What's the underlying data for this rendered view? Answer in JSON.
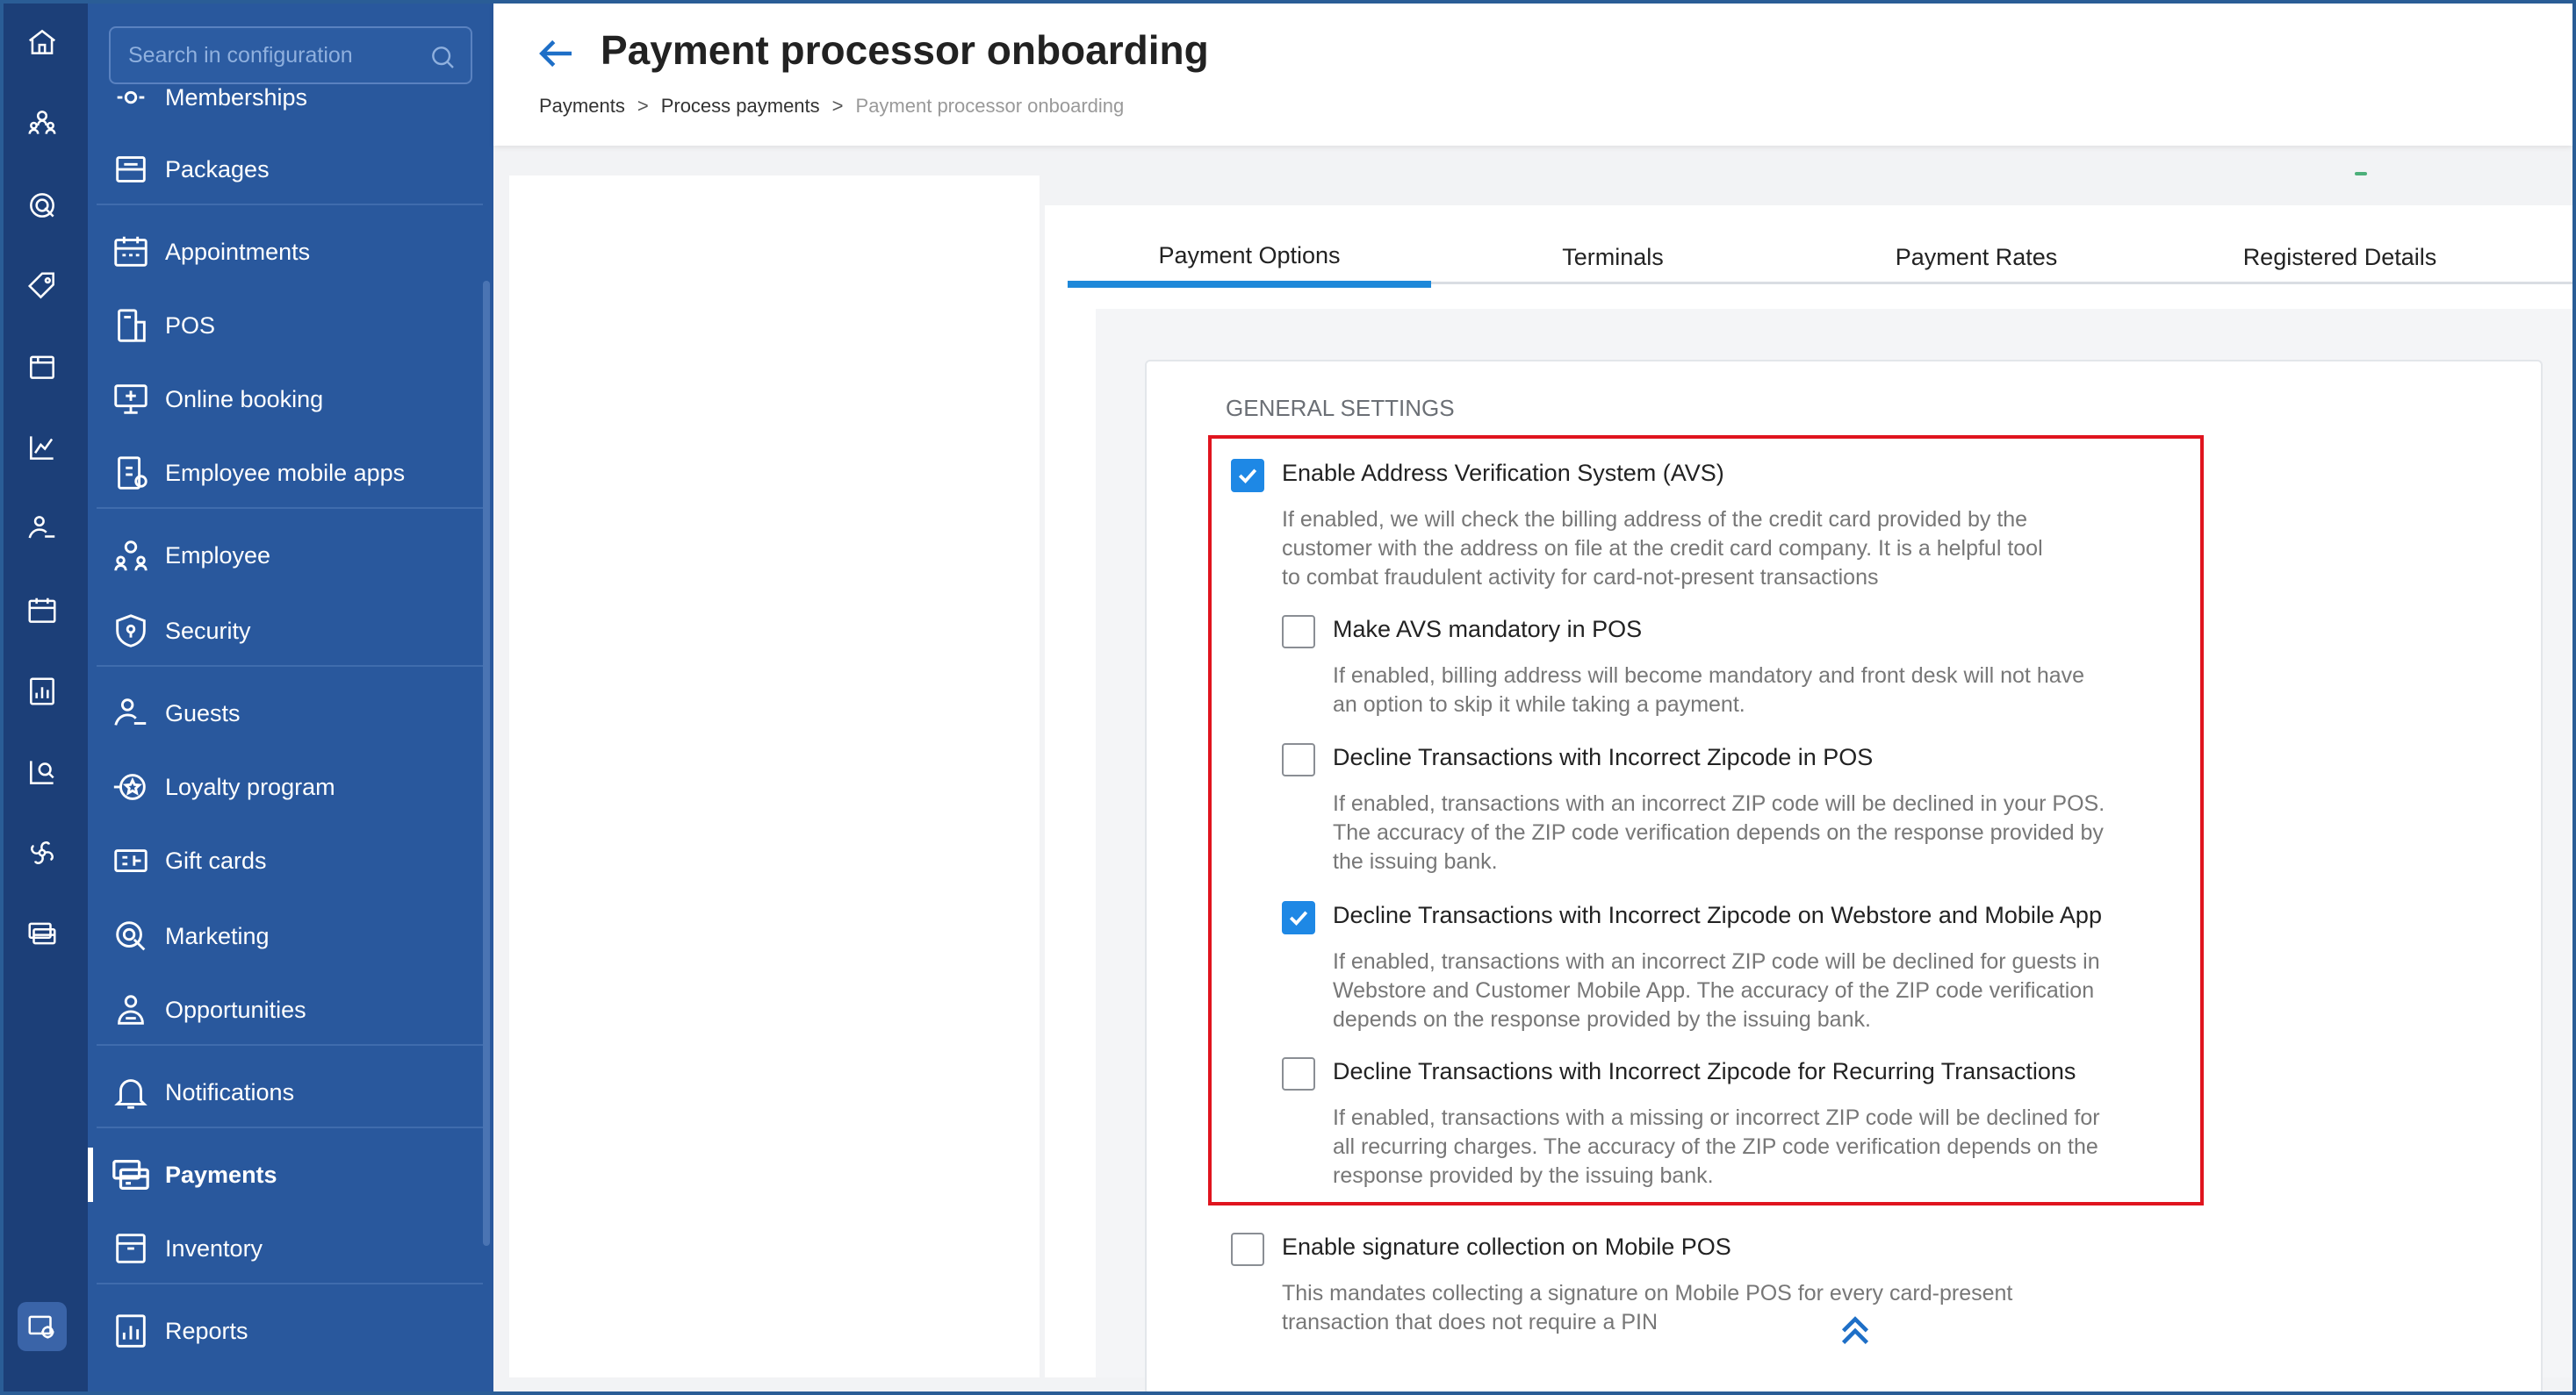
{
  "sidebar": {
    "search_placeholder": "Search in configuration",
    "items": [
      {
        "label": "Memberships",
        "icon": "memberships-icon"
      },
      {
        "label": "Packages",
        "icon": "packages-icon"
      },
      {
        "label": "Appointments",
        "icon": "calendar-icon"
      },
      {
        "label": "POS",
        "icon": "pos-icon"
      },
      {
        "label": "Online booking",
        "icon": "online-booking-icon"
      },
      {
        "label": "Employee mobile apps",
        "icon": "mobile-apps-icon"
      },
      {
        "label": "Employee",
        "icon": "employee-icon"
      },
      {
        "label": "Security",
        "icon": "shield-icon"
      },
      {
        "label": "Guests",
        "icon": "guests-icon"
      },
      {
        "label": "Loyalty program",
        "icon": "loyalty-icon"
      },
      {
        "label": "Gift cards",
        "icon": "gift-card-icon"
      },
      {
        "label": "Marketing",
        "icon": "marketing-icon"
      },
      {
        "label": "Opportunities",
        "icon": "opportunities-icon"
      },
      {
        "label": "Notifications",
        "icon": "bell-icon"
      },
      {
        "label": "Payments",
        "icon": "payments-icon",
        "active": true
      },
      {
        "label": "Inventory",
        "icon": "inventory-icon"
      },
      {
        "label": "Reports",
        "icon": "reports-icon"
      }
    ]
  },
  "header": {
    "title": "Payment processor onboarding",
    "breadcrumb": [
      "Payments",
      "Process payments",
      "Payment processor onboarding"
    ]
  },
  "tabs": [
    "Payment Options",
    "Terminals",
    "Payment Rates",
    "Registered Details"
  ],
  "active_tab": "Payment Options",
  "settings": {
    "section_title": "GENERAL SETTINGS",
    "options": [
      {
        "label": "Enable Address Verification System (AVS)",
        "checked": true,
        "desc": [
          "If enabled, we will check the billing address of the credit card provided by the",
          "customer with the address on file at the credit card company. It is a helpful tool",
          "to combat fraudulent activity for card-not-present transactions"
        ]
      },
      {
        "label": "Make AVS mandatory in POS",
        "checked": false,
        "desc": [
          "If enabled, billing address will become mandatory and front desk will not have",
          "an option to skip it while taking a payment."
        ]
      },
      {
        "label": "Decline Transactions with Incorrect Zipcode in POS",
        "checked": false,
        "desc": [
          "If enabled, transactions with an incorrect ZIP code will be declined in your POS.",
          "The accuracy of the ZIP code verification depends on the response provided by",
          "the issuing bank."
        ]
      },
      {
        "label": "Decline Transactions with Incorrect Zipcode on Webstore and Mobile App",
        "checked": true,
        "desc": [
          "If enabled, transactions with an incorrect ZIP code will be declined for guests in",
          "Webstore and Customer Mobile App. The accuracy of the ZIP code verification",
          "depends on the response provided by the issuing bank."
        ]
      },
      {
        "label": "Decline Transactions with Incorrect Zipcode for Recurring Transactions",
        "checked": false,
        "desc": [
          "If enabled, transactions with a missing or incorrect ZIP code will be declined for",
          "all recurring charges. The accuracy of the ZIP code verification depends on the",
          "response provided by the issuing bank."
        ]
      },
      {
        "label": "Enable signature collection on Mobile POS",
        "checked": false,
        "desc": [
          "This mandates collecting a signature on Mobile POS for every card-present",
          "transaction that does not require a PIN"
        ]
      }
    ]
  },
  "colors": {
    "rail": "#1c3f78",
    "sidebar": "#29589d",
    "accent": "#1e88e5",
    "highlight": "#e0141e"
  }
}
